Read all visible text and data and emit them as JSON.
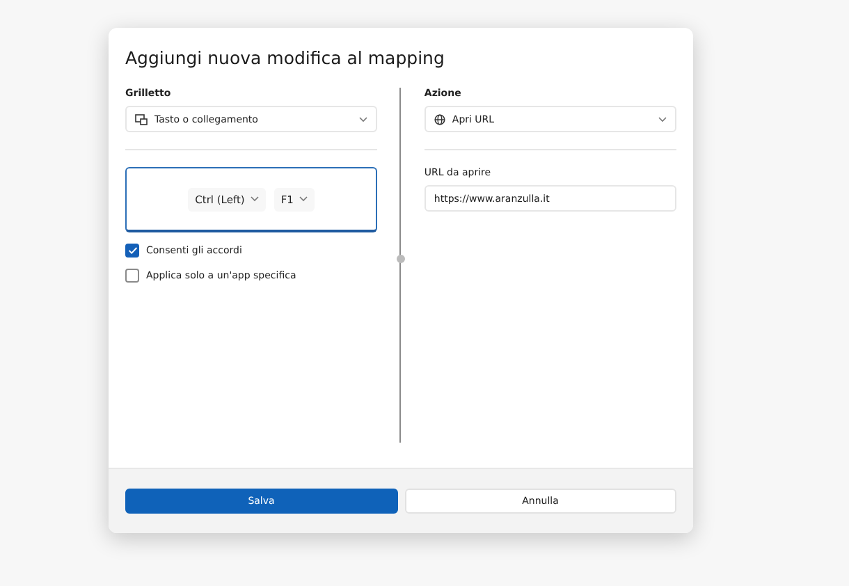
{
  "dialog": {
    "title": "Aggiungi nuova modifica al mapping"
  },
  "trigger": {
    "label": "Grilletto",
    "value": "Tasto o collegamento",
    "keys": [
      "Ctrl (Left)",
      "F1"
    ]
  },
  "options": [
    {
      "label": "Consenti gli accordi",
      "checked": true
    },
    {
      "label": "Applica solo a un'app specifica",
      "checked": false
    }
  ],
  "action": {
    "label": "Azione",
    "value": "Apri URL",
    "url_label": "URL da aprire",
    "url": "https://www.aranzulla.it"
  },
  "buttons": [
    {
      "label": "Salva",
      "kind": "primary"
    },
    {
      "label": "Annulla",
      "kind": "secondary"
    }
  ]
}
